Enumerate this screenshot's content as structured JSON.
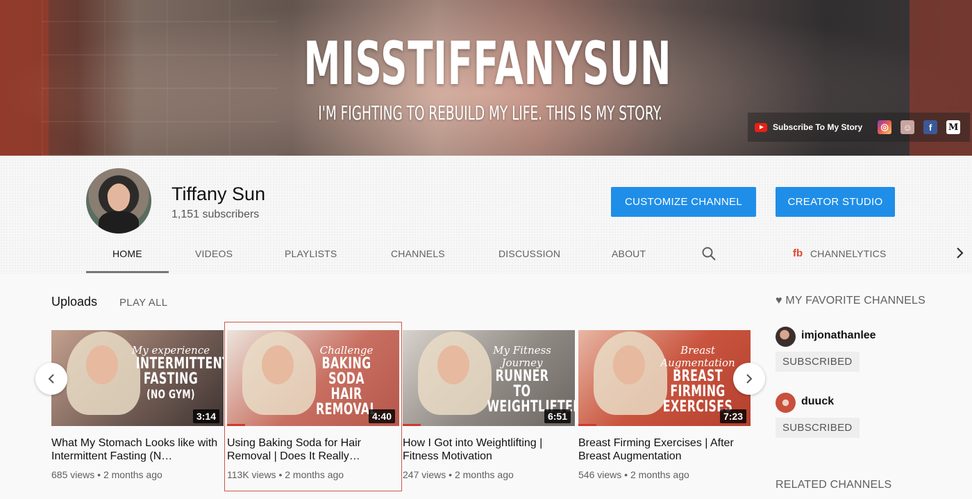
{
  "banner": {
    "title": "MISSTIFFANYSUN",
    "subtitle": "I'M FIGHTING TO REBUILD MY LIFE. THIS IS MY STORY.",
    "link_label": "Subscribe To My Story",
    "social_icons": [
      "instagram-icon",
      "snapchat-icon",
      "facebook-icon",
      "medium-icon"
    ]
  },
  "channel": {
    "name": "Tiffany Sun",
    "subscribers": "1,151 subscribers",
    "customize_label": "CUSTOMIZE CHANNEL",
    "studio_label": "CREATOR STUDIO",
    "accent": "#1f8ee8"
  },
  "tabs": {
    "home": "HOME",
    "videos": "VIDEOS",
    "playlists": "PLAYLISTS",
    "channels": "CHANNELS",
    "discussion": "DISCUSSION",
    "about": "ABOUT",
    "channelytics": "CHANNELYTICS"
  },
  "uploads": {
    "title": "Uploads",
    "play_all": "PLAY ALL",
    "videos": [
      {
        "thumb_script": "My experience",
        "thumb_lines": [
          "INTERMITTENT",
          "FASTING",
          "(NO GYM)"
        ],
        "duration": "3:14",
        "title": "What My Stomach Looks like with Intermittent Fasting (N…",
        "views": "685 views",
        "age": "2 months ago",
        "bg": "#8c6f63"
      },
      {
        "thumb_script": "Challenge",
        "thumb_lines": [
          "BAKING SODA",
          "HAIR REMOVAL"
        ],
        "duration": "4:40",
        "title": "Using Baking Soda for Hair Removal | Does It Really…",
        "views": "113K views",
        "age": "2 months ago",
        "bg": "#b9665a"
      },
      {
        "thumb_script": "My Fitness Journey",
        "thumb_lines": [
          "RUNNER TO",
          "WEIGHTLIFTER"
        ],
        "duration": "6:51",
        "title": "How I Got into Weightlifting | Fitness Motivation",
        "views": "247 views",
        "age": "2 months ago",
        "bg": "#9a948e"
      },
      {
        "thumb_script": "Breast Augmentation",
        "thumb_lines": [
          "BREAST",
          "FIRMING",
          "EXERCISES"
        ],
        "duration": "7:23",
        "title": "Breast Firming Exercises | After Breast Augmentation",
        "views": "546 views",
        "age": "2 months ago",
        "bg": "#c4573f"
      }
    ]
  },
  "sidebar": {
    "favorites_title": "♥ MY FAVORITE CHANNELS",
    "channels": [
      {
        "name": "imjonathanlee",
        "status": "SUBSCRIBED"
      },
      {
        "name": "duuck",
        "status": "SUBSCRIBED"
      }
    ],
    "related_title": "RELATED CHANNELS"
  }
}
